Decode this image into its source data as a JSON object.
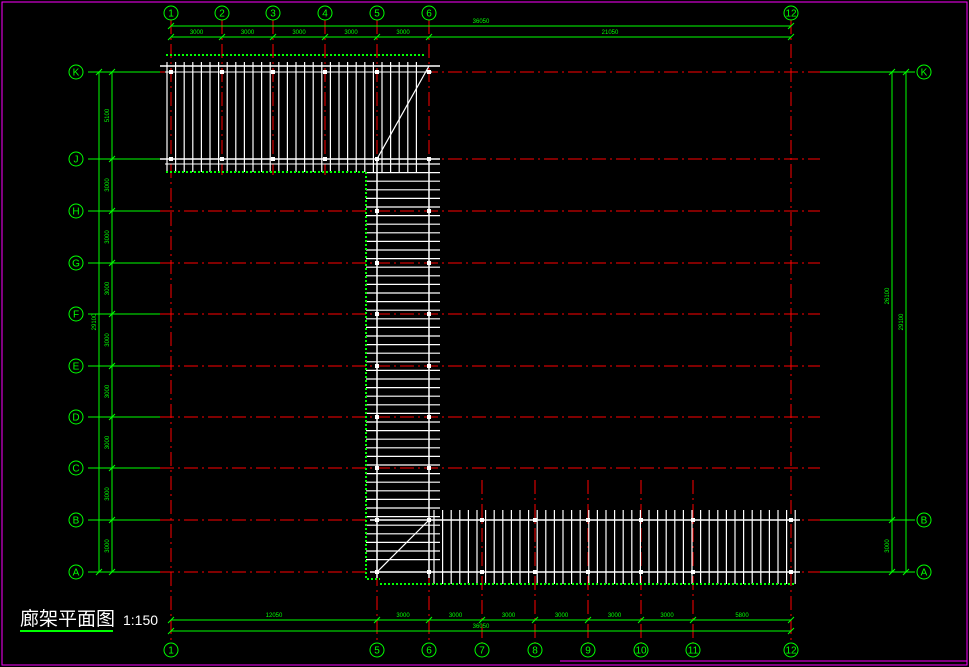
{
  "drawing": {
    "title": "廊架平面图",
    "scale": "1:150",
    "colors": {
      "background": "#000000",
      "axis": "#00ff00",
      "centerline": "#ff0000",
      "structure": "#ffffff",
      "frame": "#ff00ff"
    }
  },
  "axes": {
    "top": [
      "1",
      "2",
      "3",
      "4",
      "5",
      "6",
      "12"
    ],
    "bottom": [
      "1",
      "5",
      "6",
      "7",
      "8",
      "9",
      "10",
      "11",
      "12"
    ],
    "left": [
      "K",
      "J",
      "H",
      "G",
      "F",
      "E",
      "D",
      "C",
      "B",
      "A"
    ],
    "right": [
      "K",
      "B",
      "A"
    ]
  },
  "dimensions": {
    "top_segments": [
      "3000",
      "3000",
      "3000",
      "3000",
      "3000",
      "21050"
    ],
    "top_total": "36050",
    "bottom_segments": [
      "12050",
      "3000",
      "3000",
      "3000",
      "3000",
      "3000",
      "3000",
      "5800"
    ],
    "bottom_total": "36050",
    "left_segments": [
      "5100",
      "3000",
      "3000",
      "3000",
      "3000",
      "3000",
      "3000",
      "3000",
      "3000",
      "3000"
    ],
    "left_total": "29100",
    "right_segments": [
      "26100",
      "3000"
    ],
    "right_total": "29100"
  }
}
